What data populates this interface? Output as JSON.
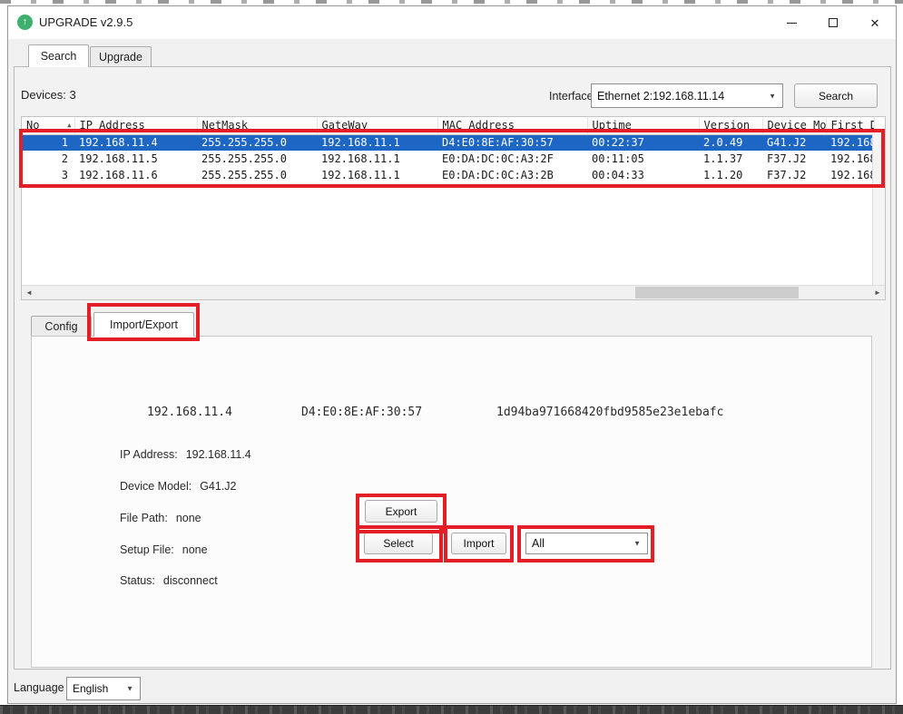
{
  "window": {
    "title": "UPGRADE v2.9.5"
  },
  "main_tabs": {
    "search": "Search",
    "upgrade": "Upgrade"
  },
  "toolbar": {
    "devices_label": "Devices: 3",
    "interface_label": "Interface",
    "interface_value": "Ethernet  2:192.168.11.14",
    "search_button": "Search"
  },
  "device_table": {
    "columns": [
      "No",
      "IP Address",
      "NetMask",
      "GateWay",
      "MAC Address",
      "Uptime",
      "Version",
      "Device Mo",
      "First De"
    ],
    "rows": [
      {
        "no": "1",
        "ip": "192.168.11.4",
        "netmask": "255.255.255.0",
        "gateway": "192.168.11.1",
        "mac": "D4:E0:8E:AF:30:57",
        "uptime": "00:22:37",
        "version": "2.0.49",
        "model": "G41.J2",
        "first": "192.168"
      },
      {
        "no": "2",
        "ip": "192.168.11.5",
        "netmask": "255.255.255.0",
        "gateway": "192.168.11.1",
        "mac": "E0:DA:DC:0C:A3:2F",
        "uptime": "00:11:05",
        "version": "1.1.37",
        "model": "F37.J2",
        "first": "192.168"
      },
      {
        "no": "3",
        "ip": "192.168.11.6",
        "netmask": "255.255.255.0",
        "gateway": "192.168.11.1",
        "mac": "E0:DA:DC:0C:A3:2B",
        "uptime": "00:04:33",
        "version": "1.1.20",
        "model": "F37.J2",
        "first": "192.168"
      }
    ]
  },
  "detail_tabs": {
    "config": "Config",
    "import_export": "Import/Export"
  },
  "detail": {
    "summary": {
      "ip": "192.168.11.4",
      "mac": "D4:E0:8E:AF:30:57",
      "hash": "1d94ba971668420fbd9585e23e1ebafc"
    },
    "fields": [
      {
        "label": "IP Address:",
        "value": "192.168.11.4"
      },
      {
        "label": "Device Model:",
        "value": "G41.J2"
      },
      {
        "label": "File Path:",
        "value": "none"
      },
      {
        "label": "Setup File:",
        "value": "none"
      },
      {
        "label": "Status:",
        "value": "disconnect"
      }
    ],
    "export_button": "Export",
    "select_button": "Select",
    "import_button": "Import",
    "import_scope_value": "All"
  },
  "footer": {
    "language_label": "Language",
    "language_value": "English"
  },
  "icons": {
    "app_up_arrow": "↑",
    "sort_ascending": "▲",
    "dropdown_arrow": "▼",
    "scroll_left": "◄",
    "scroll_right": "►",
    "close": "✕"
  },
  "colors": {
    "selection_blue": "#1d66c4",
    "annotation_red": "#e41e26",
    "icon_green": "#3faf6e"
  }
}
